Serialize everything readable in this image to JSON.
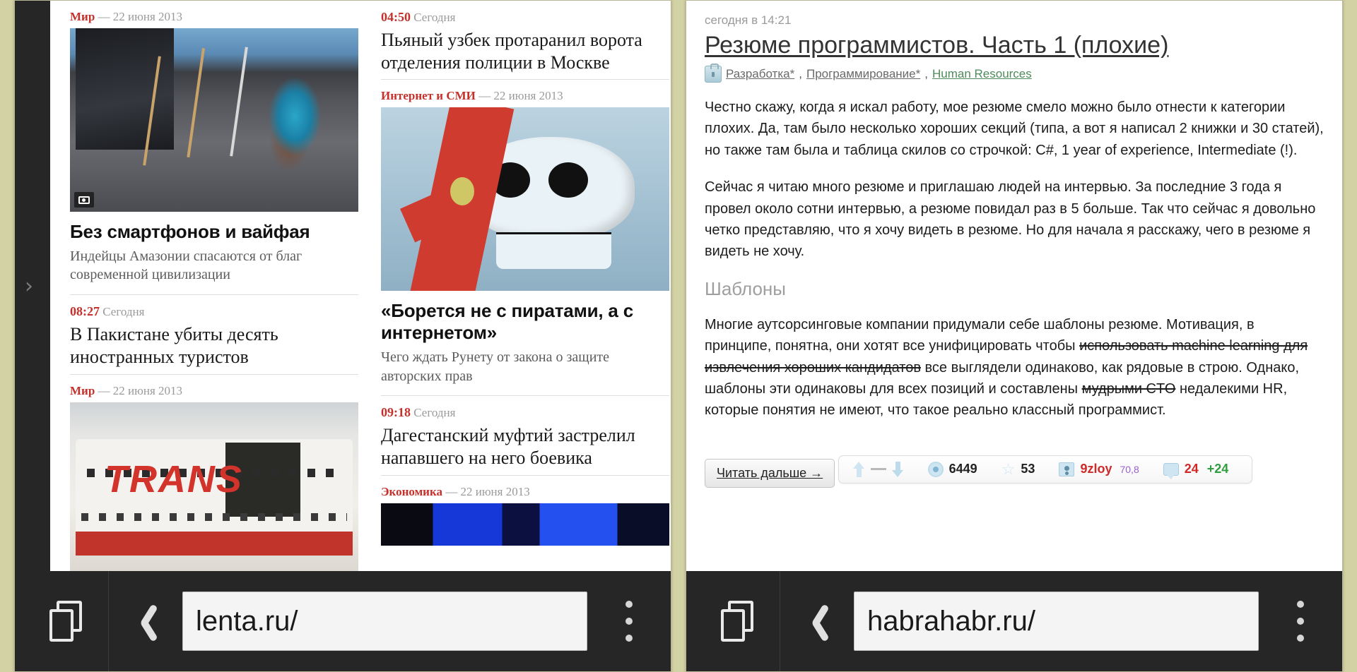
{
  "background_color": "#d3d2a4",
  "left_window": {
    "site": "lenta.ru",
    "browser": {
      "tabs_label": "tabs-icon",
      "back_label": "back-icon",
      "url": "lenta.ru/",
      "url_placeholder": "Search or type URL",
      "menu_label": "menu-icon"
    },
    "rail": {
      "expand_glyph": "›"
    },
    "column_a": [
      {
        "category": "Мир",
        "dash": "—",
        "date": "22 июня 2013",
        "photo_badge": "camera-icon",
        "headline": "Без смартфонов и вайфая",
        "subhead": "Индейцы Амазонии спасаются от благ современной цивилизации"
      },
      {
        "time": "08:27",
        "today": "Сегодня",
        "headline": "В Пакистане убиты десять иностранных туристов"
      },
      {
        "category": "Мир",
        "dash": "—",
        "date": "22 июня 2013"
      }
    ],
    "column_b": [
      {
        "time": "04:50",
        "today": "Сегодня",
        "headline": "Пьяный узбек протаранил ворота отделения полиции в Москве"
      },
      {
        "category": "Интернет и СМИ",
        "dash": "—",
        "date": "22 июня 2013",
        "headline": "«Борется не с пиратами, а с интернетом»",
        "subhead": "Чего ждать Рунету от закона о защите авторских прав"
      },
      {
        "time": "09:18",
        "today": "Сегодня",
        "headline": "Дагестанский муфтий застрелил напавшего на него боевика"
      },
      {
        "category": "Экономика",
        "dash": "—",
        "date": "22 июня 2013"
      }
    ]
  },
  "right_window": {
    "site": "habrahabr.ru",
    "browser": {
      "tabs_label": "tabs-icon",
      "back_label": "back-icon",
      "url": "habrahabr.ru/",
      "url_placeholder": "Search or type URL",
      "menu_label": "menu-icon"
    },
    "post": {
      "timestamp": "сегодня в 14:21",
      "title": "Резюме программистов. Часть 1 (плохие)",
      "hubs": [
        {
          "label": "Разработка*",
          "color": "#6a6a6a"
        },
        {
          "label": "Программирование*",
          "color": "#6a6a6a"
        },
        {
          "label": "Human Resources",
          "color": "#4e8a5b"
        }
      ],
      "hubs_separator": ", ",
      "paragraph_1": "Честно скажу, когда я искал работу, мое резюме смело можно было отнести к категории плохих. Да, там было несколько хороших секций (типа, а вот я написал 2 книжки и 30 статей), но также там была и таблица скилов со строчкой: C#, 1 year of experience, Intermediate (!).",
      "paragraph_2": "Сейчас я читаю много резюме и приглашаю людей на интервью. За последние 3 года я провел около сотни интервью, а резюме повидал раз в 5 больше. Так что сейчас я довольно четко представляю, что я хочу видеть в резюме. Но для начала я расскажу, чего в резюме я видеть не хочу.",
      "section_heading": "Шаблоны",
      "paragraph_3_a": "Многие аутсорсинговые компании придумали себе шаблоны резюме. Мотивация, в принципе, понятна, они хотят все унифицировать чтобы ",
      "paragraph_3_strike_1": "использовать machine learning для извлечения хороших кандидатов",
      "paragraph_3_b": " все выглядели одинаково, как рядовые в строю. Однако, шаблоны эти одинаковы для всех позиций и составлены ",
      "paragraph_3_strike_2": "мудрыми CTO",
      "paragraph_3_c": " недалекими HR, которые понятия не имеют, что такое реально классный программист.",
      "read_more": "Читать дальше →",
      "rating": {
        "vote_up": "arrow-up-icon",
        "vote_neutral": "dash-icon",
        "vote_down": "arrow-down-icon",
        "views_icon": "eye-icon",
        "views": "6449",
        "favorites_icon": "star-icon",
        "favorites": "53",
        "author_icon": "user-icon",
        "author": "9zloy",
        "author_karma": "70,8",
        "comments_icon": "comment-icon",
        "comments": "24",
        "comments_new": "+24"
      }
    }
  }
}
